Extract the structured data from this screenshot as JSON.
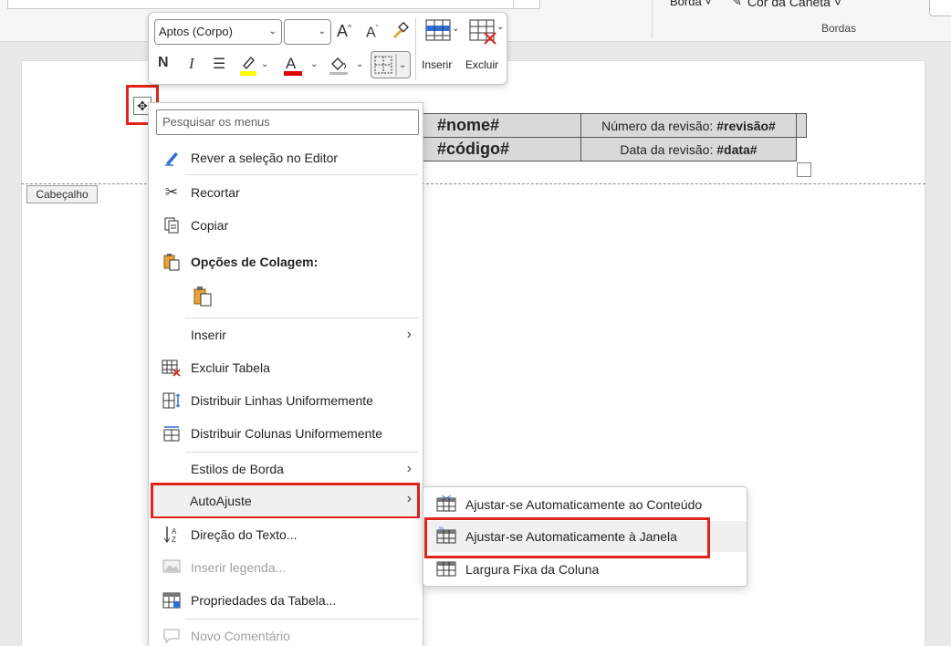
{
  "ribbon": {
    "borda": "Borda ˅",
    "cor_caneta": "Cor da Caneta ˅",
    "group_label": "Bordas"
  },
  "document": {
    "header_tag": "Cabeçalho",
    "table": {
      "row1": {
        "name": "#nome#",
        "rev_label": "Número da revisão: ",
        "rev_value": "#revisão#"
      },
      "row2": {
        "code": "#código#",
        "date_label": "Data da revisão: ",
        "date_value": "#data#"
      }
    }
  },
  "mini_toolbar": {
    "font": "Aptos (Corpo)",
    "size": "",
    "bold": "N",
    "italic": "I",
    "inserir": "Inserir",
    "excluir": "Excluir",
    "colors": {
      "highlight": "#ffff00",
      "font_color": "#e00000"
    }
  },
  "context_menu": {
    "search_placeholder": "Pesquisar os menus",
    "items": [
      {
        "label": "Rever a seleção no Editor",
        "icon": "editor-pen-icon"
      },
      {
        "label": "Recortar",
        "icon": "scissors-icon"
      },
      {
        "label": "Copiar",
        "icon": "copy-icon"
      },
      {
        "label": "Opções de Colagem:",
        "icon": "paste-icon"
      },
      {
        "label": "Inserir",
        "icon": ""
      },
      {
        "label": "Excluir Tabela",
        "icon": "delete-table-icon"
      },
      {
        "label": "Distribuir Linhas Uniformemente",
        "icon": "distribute-rows-icon"
      },
      {
        "label": "Distribuir Colunas Uniformemente",
        "icon": "distribute-columns-icon"
      },
      {
        "label": "Estilos de Borda",
        "icon": ""
      },
      {
        "label": "AutoAjuste",
        "icon": ""
      },
      {
        "label": "Direção do Texto...",
        "icon": "text-direction-icon"
      },
      {
        "label": "Inserir legenda...",
        "icon": "caption-icon"
      },
      {
        "label": "Propriedades da Tabela...",
        "icon": "table-properties-icon"
      },
      {
        "label": "Novo Comentário",
        "icon": "comment-icon"
      }
    ]
  },
  "submenu": {
    "items": [
      {
        "label": "Ajustar-se Automaticamente ao Conteúdo"
      },
      {
        "label": "Ajustar-se Automaticamente à Janela"
      },
      {
        "label": "Largura Fixa da Coluna"
      }
    ]
  }
}
